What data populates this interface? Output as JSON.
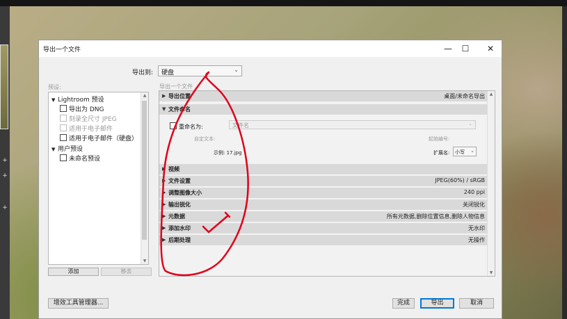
{
  "dialog": {
    "title": "导出一个文件",
    "minimize_icon": "minimize-icon",
    "maximize_icon": "maximize-icon",
    "close_icon": "close-icon"
  },
  "export_to": {
    "label": "导出到:",
    "value": "硬盘"
  },
  "presets": {
    "label": "预设:",
    "groups": [
      {
        "name": "Lightroom 预设",
        "items": [
          {
            "label": "导出为 DNG",
            "enabled": true
          },
          {
            "label": "刻录全尺寸 JPEG",
            "enabled": false
          },
          {
            "label": "适用于电子邮件",
            "enabled": false
          },
          {
            "label": "适用于电子邮件（硬盘）",
            "enabled": true
          }
        ]
      },
      {
        "name": "用户预设",
        "items": [
          {
            "label": "未命名预设",
            "enabled": true
          }
        ]
      }
    ],
    "add_label": "添加",
    "remove_label": "移去"
  },
  "main": {
    "caption": "导出一个文件",
    "sections": [
      {
        "title": "导出位置",
        "summary": "桌面/未命名导出",
        "expanded": false
      },
      {
        "title": "文件命名",
        "summary": "",
        "expanded": true
      },
      {
        "title": "视频",
        "summary": "",
        "expanded": false
      },
      {
        "title": "文件设置",
        "summary": "JPEG(60%) / sRGB",
        "expanded": false
      },
      {
        "title": "调整图像大小",
        "summary": "240 ppi",
        "expanded": false
      },
      {
        "title": "输出锐化",
        "summary": "关闭锐化",
        "expanded": false
      },
      {
        "title": "元数据",
        "summary": "所有元数据,删除位置信息,删除人物信息",
        "expanded": false
      },
      {
        "title": "添加水印",
        "summary": "无水印",
        "expanded": false
      },
      {
        "title": "后期处理",
        "summary": "无操作",
        "expanded": false
      }
    ],
    "file_naming": {
      "rename_label": "重命名为:",
      "rename_value": "文件名",
      "custom_text_label": "自定文本:",
      "start_number_label": "起始编号:",
      "example": "示例: 17.jpg",
      "extension_label": "扩展名:",
      "extension_value": "小写"
    }
  },
  "footer": {
    "plugin_manager_label": "增效工具管理器...",
    "done_label": "完成",
    "export_label": "导出",
    "cancel_label": "取消"
  },
  "colors": {
    "annotation": "#e0001b",
    "accent": "#0078d7"
  }
}
